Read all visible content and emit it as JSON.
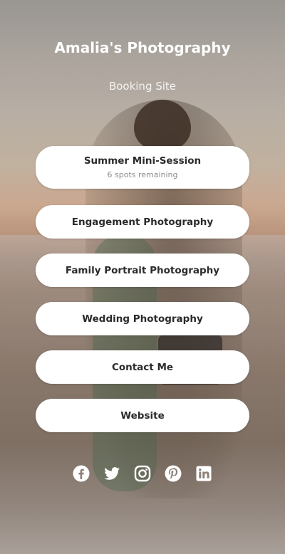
{
  "profile": {
    "name": "Amalia's Photography",
    "tagline": "Booking Site"
  },
  "links": [
    {
      "label": "Summer Mini-Session",
      "sublabel": "6 spots remaining"
    },
    {
      "label": "Engagement Photography"
    },
    {
      "label": "Family Portrait Photography"
    },
    {
      "label": "Wedding Photography"
    },
    {
      "label": "Contact Me"
    },
    {
      "label": "Website"
    }
  ],
  "socials": [
    "facebook-icon",
    "twitter-icon",
    "instagram-icon",
    "pinterest-icon",
    "linkedin-icon"
  ],
  "colors": {
    "button_bg": "#ffffff",
    "button_text": "#2b2b2b",
    "sublabel_text": "#8c8c8c",
    "icon": "#ffffff"
  }
}
